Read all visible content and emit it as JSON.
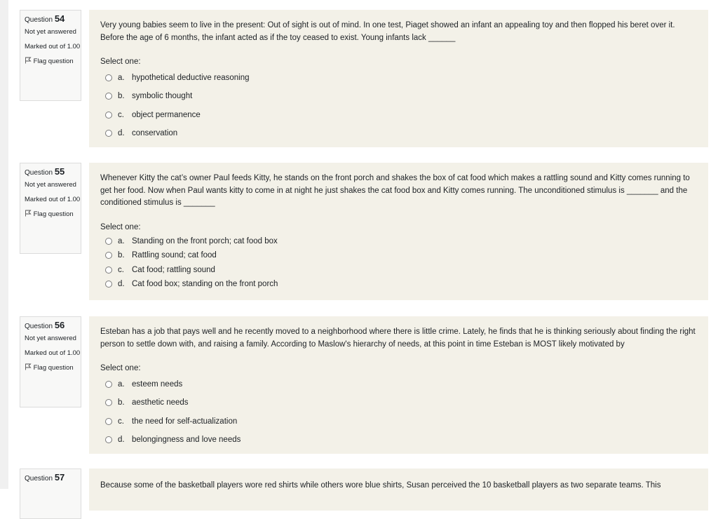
{
  "questions": [
    {
      "label": "Question",
      "number": "54",
      "state": "Not yet answered",
      "grade": "Marked out of 1.00",
      "flag_label": "Flag question",
      "text": "Very young babies seem to live in the present: Out of sight is out of mind. In one test, Piaget showed an infant an appealing toy and then flopped his beret over it. Before the age of 6 months, the infant acted as if the toy ceased to exist. Young infants lack ______",
      "prompt": "Select one:",
      "options": [
        {
          "letter": "a.",
          "text": "hypothetical deductive reasoning"
        },
        {
          "letter": "b.",
          "text": "symbolic thought"
        },
        {
          "letter": "c.",
          "text": "object permanence"
        },
        {
          "letter": "d.",
          "text": "conservation"
        }
      ]
    },
    {
      "label": "Question",
      "number": "55",
      "state": "Not yet answered",
      "grade": "Marked out of 1.00",
      "flag_label": "Flag question",
      "text": "Whenever Kitty the cat’s owner Paul feeds Kitty, he stands on the front porch and shakes the box of cat food which makes a rattling sound and Kitty comes running to get her food.  Now when Paul wants kitty to come in at night he just shakes the cat food box and Kitty comes running. The unconditioned stimulus is _______ and the conditioned stimulus is _______",
      "prompt": "Select one:",
      "options": [
        {
          "letter": "a.",
          "text": "Standing on the front porch; cat food box"
        },
        {
          "letter": "b.",
          "text": "Rattling sound; cat food"
        },
        {
          "letter": "c.",
          "text": "Cat food; rattling sound"
        },
        {
          "letter": "d.",
          "text": "Cat food box; standing on the front porch"
        }
      ]
    },
    {
      "label": "Question",
      "number": "56",
      "state": "Not yet answered",
      "grade": "Marked out of 1.00",
      "flag_label": "Flag question",
      "text": "Esteban has a job that pays well and he recently moved to a neighborhood where there is little crime. Lately, he finds that he is thinking seriously about finding the right person to settle down with, and raising a family. According to Maslow's hierarchy of needs, at this point in time Esteban is MOST likely motivated by",
      "prompt": "Select one:",
      "options": [
        {
          "letter": "a.",
          "text": "esteem needs"
        },
        {
          "letter": "b.",
          "text": "aesthetic needs"
        },
        {
          "letter": "c.",
          "text": "the need for self-actualization"
        },
        {
          "letter": "d.",
          "text": "belongingness and love needs"
        }
      ]
    },
    {
      "label": "Question",
      "number": "57",
      "text": "Because some of the basketball players wore red shirts while others wore blue shirts, Susan perceived the 10 basketball players as two separate teams. This"
    }
  ]
}
